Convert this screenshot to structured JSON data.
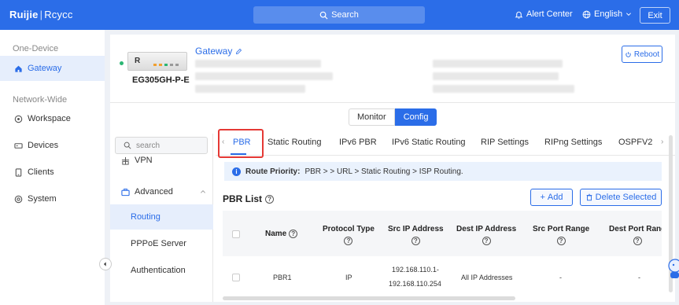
{
  "brand": {
    "logo_main": "Ruijie",
    "logo_sep": "|",
    "logo_sub": "Rcycc"
  },
  "topbar": {
    "search_label": "Search",
    "alert_label": "Alert Center",
    "language_label": "English",
    "exit_label": "Exit"
  },
  "sidebar": {
    "section_one": "One-Device",
    "gateway_label": "Gateway",
    "section_network": "Network-Wide",
    "items": [
      {
        "label": "Workspace",
        "icon": "workspace-icon"
      },
      {
        "label": "Devices",
        "icon": "devices-icon"
      },
      {
        "label": "Clients",
        "icon": "clients-icon"
      },
      {
        "label": "System",
        "icon": "system-icon"
      }
    ]
  },
  "device": {
    "name": "Gateway",
    "model": "EG305GH-P-E",
    "logo_letter": "R",
    "reboot_label": "Reboot",
    "status_color": "#2bb673"
  },
  "mode": {
    "monitor": "Monitor",
    "config": "Config"
  },
  "inner_nav": {
    "search_placeholder": "search",
    "vpn": "VPN",
    "advanced": "Advanced",
    "routing": "Routing",
    "pppoe": "PPPoE Server",
    "auth": "Authentication"
  },
  "tabs": [
    "PBR",
    "Static Routing",
    "IPv6 PBR",
    "IPv6 Static Routing",
    "RIP Settings",
    "RIPng Settings",
    "OSPFV2"
  ],
  "info": {
    "label": "Route Priority:",
    "text": "PBR > > URL > Static Routing > ISP Routing."
  },
  "list": {
    "title": "PBR List",
    "add_label": "Add",
    "delete_label": "Delete Selected"
  },
  "table": {
    "headers": [
      "Name",
      "Protocol Type",
      "Src IP Address",
      "Dest IP Address",
      "Src Port Range",
      "Dest Port Rang"
    ],
    "rows": [
      {
        "name": "PBR1",
        "protocol": "IP",
        "src_ip_1": "192.168.110.1-",
        "src_ip_2": "192.168.110.254",
        "dest_ip": "All IP Addresses",
        "src_port": "-",
        "dest_port": "-"
      }
    ]
  },
  "colors": {
    "primary": "#2b6de8",
    "highlight": "#e53935"
  }
}
